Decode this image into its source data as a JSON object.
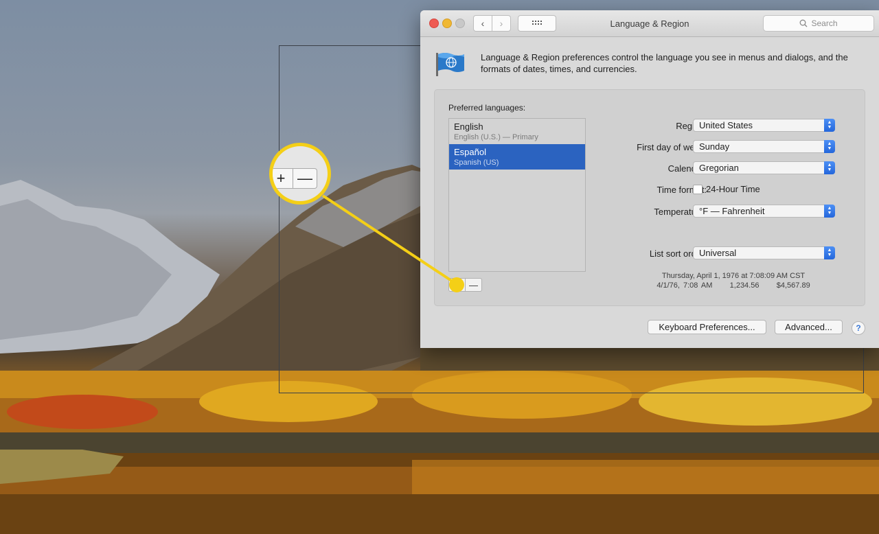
{
  "window": {
    "title": "Language & Region",
    "search_placeholder": "Search"
  },
  "intro": {
    "text": "Language & Region preferences control the language you see in menus and dialogs, and the formats of dates, times, and currencies."
  },
  "languages": {
    "label": "Preferred languages:",
    "items": [
      {
        "name": "English",
        "sub": "English (U.S.) — Primary",
        "selected": false
      },
      {
        "name": "Español",
        "sub": "Spanish (US)",
        "selected": true
      }
    ],
    "plus": "+",
    "minus": "—"
  },
  "settings": {
    "region": {
      "label": "Region:",
      "value": "United States"
    },
    "first_day": {
      "label": "First day of week:",
      "value": "Sunday"
    },
    "calendar": {
      "label": "Calendar:",
      "value": "Gregorian"
    },
    "time_format": {
      "label": "Time format:",
      "checkbox_label": "24-Hour Time",
      "checked": false
    },
    "temperature": {
      "label": "Temperature:",
      "value": "°F — Fahrenheit"
    },
    "sort_order": {
      "label": "List sort order:",
      "value": "Universal"
    }
  },
  "example": {
    "line1": "Thursday, April 1, 1976 at 7:08:09 AM CST",
    "line2": "4/1/76, 7:08 AM     1,234.56     $4,567.89"
  },
  "buttons": {
    "keyboard": "Keyboard Preferences...",
    "advanced": "Advanced...",
    "help": "?"
  },
  "callout": {
    "plus": "+",
    "minus": "—",
    "color": "#f4cf17"
  }
}
